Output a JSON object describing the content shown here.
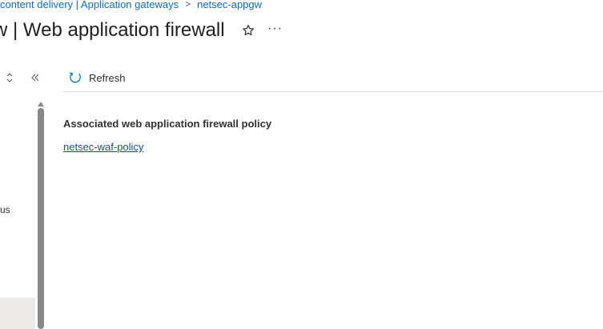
{
  "breadcrumb": {
    "items": [
      "content delivery | Application gateways",
      "netsec-appgw"
    ],
    "separator": ">"
  },
  "header": {
    "title": "w | Web application firewall",
    "favorite_icon": "star-outline-icon",
    "more_label": "···"
  },
  "left_panel": {
    "sort_icon": "sort-updown-icon",
    "collapse_label": "«",
    "partial_nav_text": "us"
  },
  "toolbar": {
    "refresh_label": "Refresh",
    "refresh_icon": "refresh-icon"
  },
  "main": {
    "section_heading": "Associated web application firewall policy",
    "policy_link": "netsec-waf-policy"
  },
  "colors": {
    "link": "#0f6cbd",
    "accent": "#0078d4",
    "text": "#323130",
    "divider": "#e1dfdd",
    "scrollbar": "#8a8886"
  }
}
